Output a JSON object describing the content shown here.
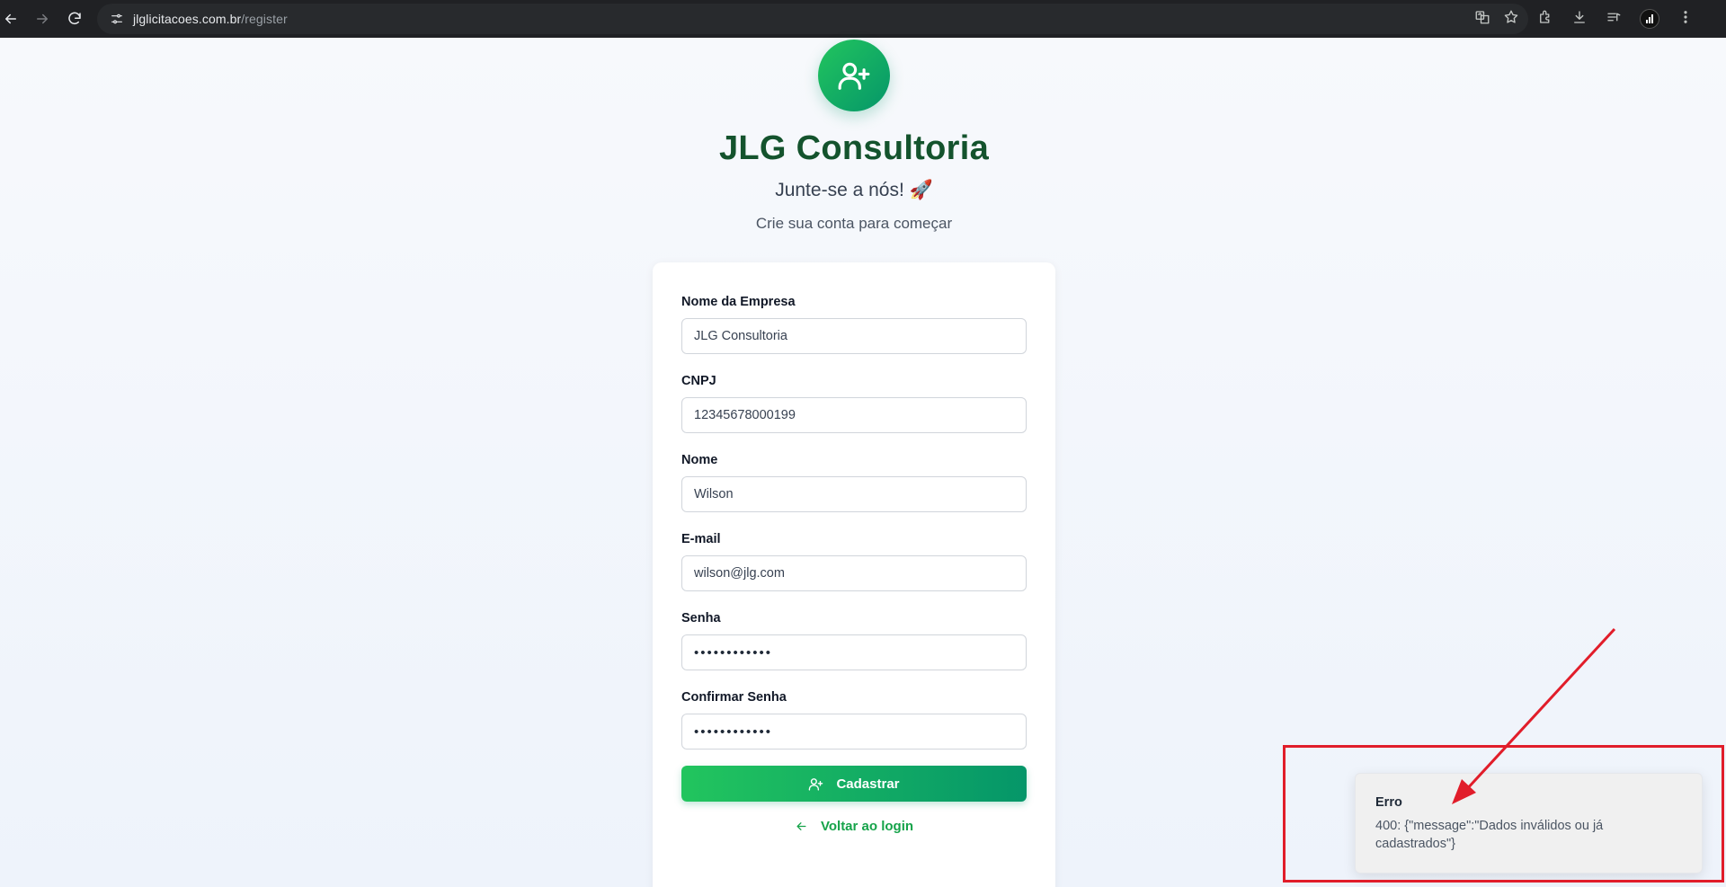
{
  "browser": {
    "url_host": "jlglicitacoes.com.br",
    "url_path": "/register"
  },
  "header": {
    "brand": "JLG Consultoria",
    "subtitle": "Junte-se a nós! 🚀",
    "caption": "Crie sua conta para começar"
  },
  "form": {
    "fields": [
      {
        "label": "Nome da Empresa",
        "value": "JLG Consultoria"
      },
      {
        "label": "CNPJ",
        "value": "12345678000199"
      },
      {
        "label": "Nome",
        "value": "Wilson"
      },
      {
        "label": "E-mail",
        "value": "wilson@jlg.com"
      },
      {
        "label": "Senha",
        "value": "••••••••••••"
      },
      {
        "label": "Confirmar Senha",
        "value": "••••••••••••"
      }
    ],
    "submit_label": "Cadastrar",
    "back_label": "Voltar ao login"
  },
  "toast": {
    "title": "Erro",
    "message": "400: {\"message\":\"Dados inválidos ou já cadastrados\"}"
  },
  "annotation": {
    "color": "#e11d2a"
  }
}
